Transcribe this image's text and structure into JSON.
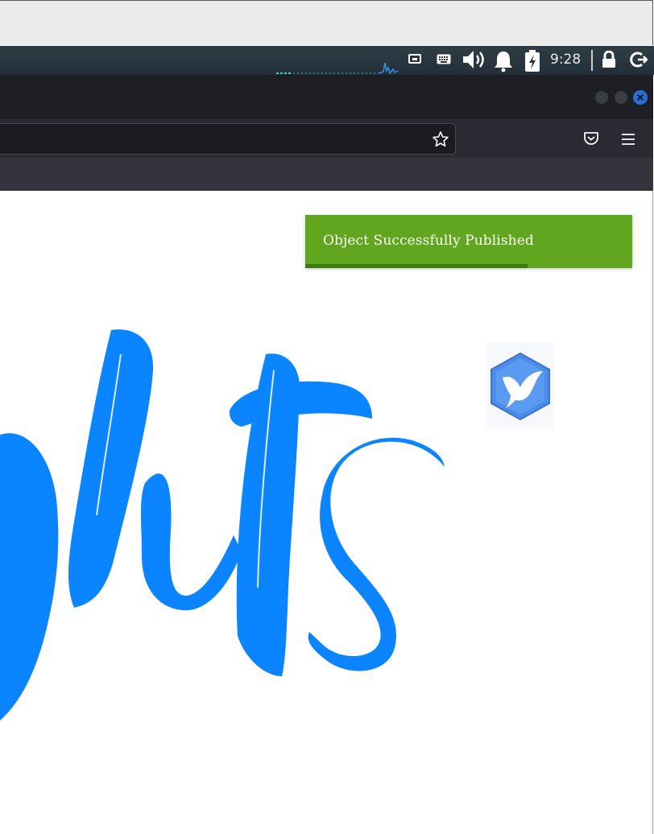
{
  "taskbar": {
    "clock": "9:28",
    "icons": [
      "network-icon",
      "keyboard-icon",
      "volume-icon",
      "notification-bell-icon",
      "battery-charging-icon",
      "lock-icon",
      "logout-icon"
    ]
  },
  "window": {
    "controls": [
      "minimize-button",
      "maximize-button",
      "close-button"
    ]
  },
  "navbar": {
    "icons": [
      "bookmark-star-icon",
      "pocket-icon",
      "hamburger-menu-icon"
    ]
  },
  "toast": {
    "message": "Object Successfully Published",
    "progress": 0.68,
    "color": "#61a61e"
  },
  "content": {
    "logo_color": "#0a84ff",
    "badge_icon": "bird-hexagon-icon"
  }
}
